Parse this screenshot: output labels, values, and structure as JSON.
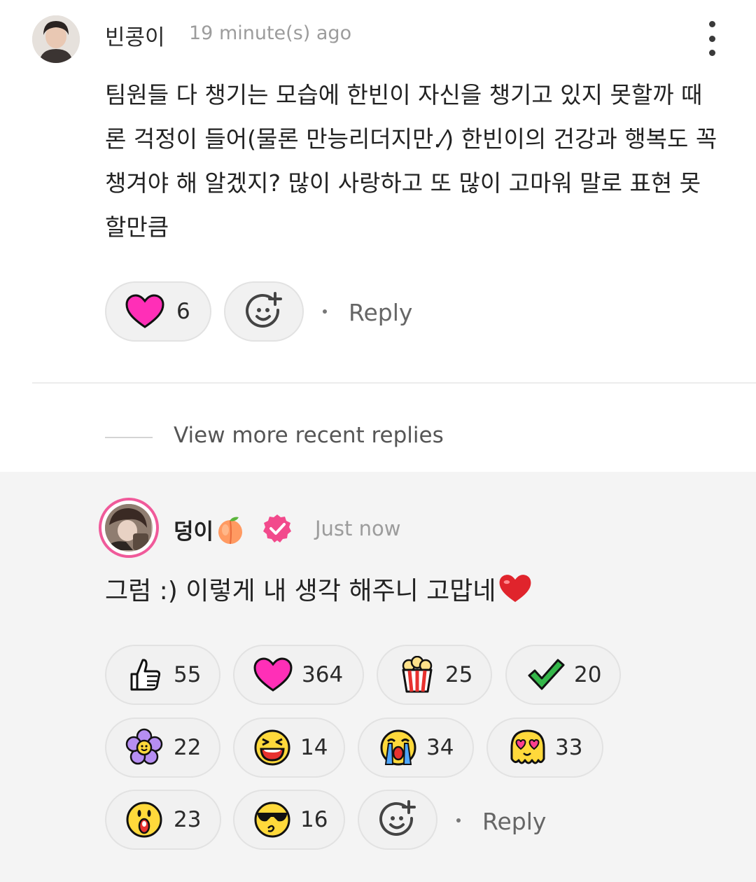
{
  "comment": {
    "username": "빈콩이",
    "timestamp": "19 minute(s) ago",
    "text": "팀원들 다 챙기는 모습에 한빈이 자신을 챙기고 있지 못할까 때론 걱정이 들어(물론 만능리더지만.⁄) 한빈이의 건강과 행복도 꼭 챙겨야 해 알겠지? 많이 사랑하고 또 많이 고마워 말로 표현 못할만큼",
    "heart_count": "6",
    "reply_label": "Reply"
  },
  "more_replies_label": "View more recent replies",
  "reply": {
    "username": "덩이",
    "timestamp": "Just now",
    "text": "그럼 :) 이렇게 내 생각 해주니 고맙네",
    "reactions": [
      {
        "icon": "thumbs-up-icon",
        "count": "55"
      },
      {
        "icon": "heart-icon",
        "count": "364"
      },
      {
        "icon": "popcorn-icon",
        "count": "25"
      },
      {
        "icon": "check-icon",
        "count": "20"
      },
      {
        "icon": "flower-icon",
        "count": "22"
      },
      {
        "icon": "laughing-face-icon",
        "count": "14"
      },
      {
        "icon": "crying-face-icon",
        "count": "34"
      },
      {
        "icon": "heart-eyes-face-icon",
        "count": "33"
      },
      {
        "icon": "surprised-face-icon",
        "count": "23"
      },
      {
        "icon": "cool-face-icon",
        "count": "16"
      }
    ],
    "reply_label": "Reply"
  },
  "colors": {
    "heart": "#ff2fb7",
    "verified": "#f24a8c",
    "avatar_ring": "#f05a9a",
    "pill_bg": "#f1f1f1",
    "reply_bg": "#f4f4f4"
  }
}
